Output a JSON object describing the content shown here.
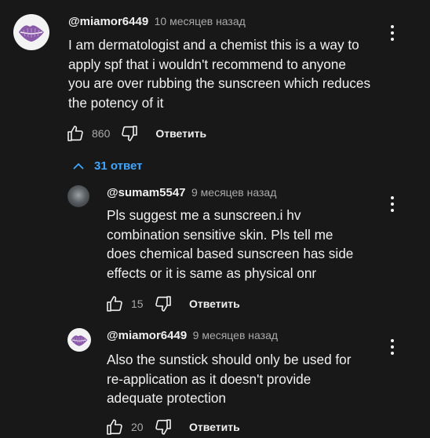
{
  "comments": [
    {
      "author": "@miamor6449",
      "date": "10 месяцев назад",
      "lines": [
        "I am dermatologist and a chemist  this is a way to",
        "apply spf that i wouldn't recommend to anyone",
        "you are over rubbing the sunscreen which reduces",
        "the potency of it"
      ],
      "likes": "860",
      "reply_label": "Ответить"
    }
  ],
  "replies_toggle": {
    "label": "31 ответ"
  },
  "replies": [
    {
      "author": "@sumam5547",
      "date": "9 месяцев назад",
      "lines": [
        "Pls suggest me a sunscreen.i hv",
        "combination sensitive skin. Pls tell me",
        "does chemical based sunscreen has side",
        "effects or it is same as physical onr"
      ],
      "likes": "15",
      "reply_label": "Ответить"
    },
    {
      "author": "@miamor6449",
      "date": "9 месяцев назад",
      "lines": [
        "Also the sunstick should only be used for",
        "re-application as it doesn't provide",
        "adequate protection"
      ],
      "likes": "20",
      "reply_label": "Ответить"
    }
  ],
  "colors": {
    "background": "#181818",
    "text": "#f1f1f1",
    "secondary": "#aaaaaa",
    "link": "#3ea6ff",
    "avatar_lips": "#8a5aa8"
  },
  "icons": [
    "lips-avatar-icon",
    "thumbs-up-icon",
    "thumbs-down-icon",
    "more-vert-icon",
    "chevron-up-icon"
  ]
}
